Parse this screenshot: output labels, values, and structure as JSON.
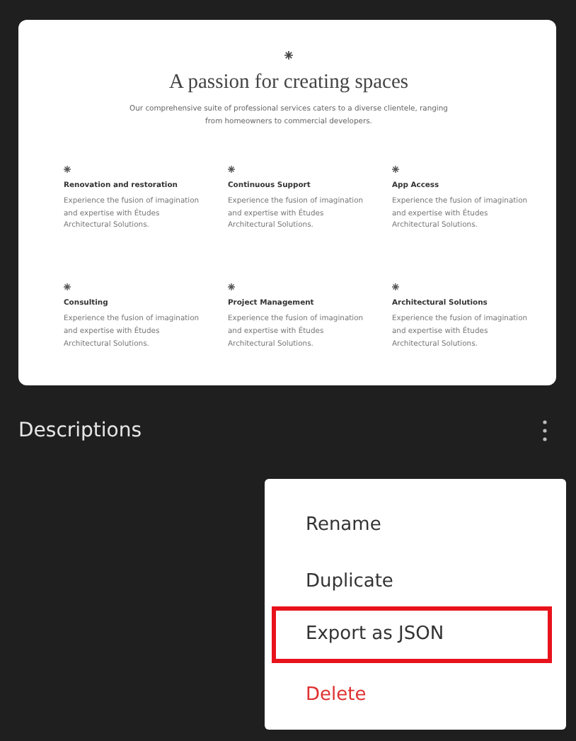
{
  "preview": {
    "title": "A passion for creating spaces",
    "subtitle": "Our comprehensive suite of professional services caters to a diverse clientele, ranging from homeowners to commercial developers.",
    "services": [
      {
        "name": "Renovation and restoration",
        "text": "Experience the fusion of imagination and expertise with Études Architectural Solutions."
      },
      {
        "name": "Continuous Support",
        "text": "Experience the fusion of imagination and expertise with Études Architectural Solutions."
      },
      {
        "name": "App Access",
        "text": "Experience the fusion of imagination and expertise with Études Architectural Solutions."
      },
      {
        "name": "Consulting",
        "text": "Experience the fusion of imagination and expertise with Études Architectural Solutions."
      },
      {
        "name": "Project Management",
        "text": "Experience the fusion of imagination and expertise with Études Architectural Solutions."
      },
      {
        "name": "Architectural Solutions",
        "text": "Experience the fusion of imagination and expertise with Études Architectural Solutions."
      }
    ]
  },
  "section": {
    "title": "Descriptions"
  },
  "menu": {
    "items": [
      {
        "label": "Rename",
        "kind": "normal",
        "highlighted": false
      },
      {
        "label": "Duplicate",
        "kind": "normal",
        "highlighted": false
      },
      {
        "label": "Export as JSON",
        "kind": "normal",
        "highlighted": true
      },
      {
        "label": "Delete",
        "kind": "danger",
        "highlighted": false
      }
    ]
  }
}
